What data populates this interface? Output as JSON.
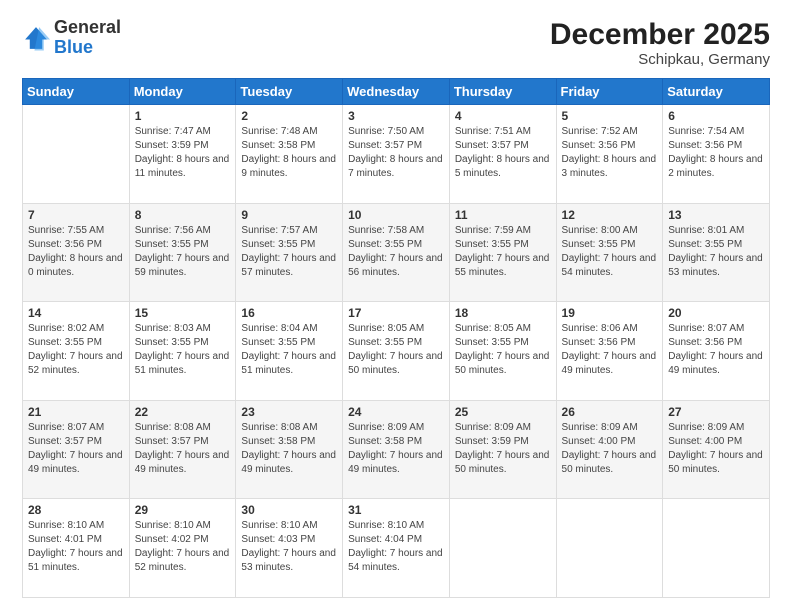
{
  "header": {
    "logo": {
      "general": "General",
      "blue": "Blue"
    },
    "title": "December 2025",
    "subtitle": "Schipkau, Germany"
  },
  "days_of_week": [
    "Sunday",
    "Monday",
    "Tuesday",
    "Wednesday",
    "Thursday",
    "Friday",
    "Saturday"
  ],
  "weeks": [
    [
      {
        "day": "",
        "sunrise": "",
        "sunset": "",
        "daylight": ""
      },
      {
        "day": "1",
        "sunrise": "Sunrise: 7:47 AM",
        "sunset": "Sunset: 3:59 PM",
        "daylight": "Daylight: 8 hours and 11 minutes."
      },
      {
        "day": "2",
        "sunrise": "Sunrise: 7:48 AM",
        "sunset": "Sunset: 3:58 PM",
        "daylight": "Daylight: 8 hours and 9 minutes."
      },
      {
        "day": "3",
        "sunrise": "Sunrise: 7:50 AM",
        "sunset": "Sunset: 3:57 PM",
        "daylight": "Daylight: 8 hours and 7 minutes."
      },
      {
        "day": "4",
        "sunrise": "Sunrise: 7:51 AM",
        "sunset": "Sunset: 3:57 PM",
        "daylight": "Daylight: 8 hours and 5 minutes."
      },
      {
        "day": "5",
        "sunrise": "Sunrise: 7:52 AM",
        "sunset": "Sunset: 3:56 PM",
        "daylight": "Daylight: 8 hours and 3 minutes."
      },
      {
        "day": "6",
        "sunrise": "Sunrise: 7:54 AM",
        "sunset": "Sunset: 3:56 PM",
        "daylight": "Daylight: 8 hours and 2 minutes."
      }
    ],
    [
      {
        "day": "7",
        "sunrise": "Sunrise: 7:55 AM",
        "sunset": "Sunset: 3:56 PM",
        "daylight": "Daylight: 8 hours and 0 minutes."
      },
      {
        "day": "8",
        "sunrise": "Sunrise: 7:56 AM",
        "sunset": "Sunset: 3:55 PM",
        "daylight": "Daylight: 7 hours and 59 minutes."
      },
      {
        "day": "9",
        "sunrise": "Sunrise: 7:57 AM",
        "sunset": "Sunset: 3:55 PM",
        "daylight": "Daylight: 7 hours and 57 minutes."
      },
      {
        "day": "10",
        "sunrise": "Sunrise: 7:58 AM",
        "sunset": "Sunset: 3:55 PM",
        "daylight": "Daylight: 7 hours and 56 minutes."
      },
      {
        "day": "11",
        "sunrise": "Sunrise: 7:59 AM",
        "sunset": "Sunset: 3:55 PM",
        "daylight": "Daylight: 7 hours and 55 minutes."
      },
      {
        "day": "12",
        "sunrise": "Sunrise: 8:00 AM",
        "sunset": "Sunset: 3:55 PM",
        "daylight": "Daylight: 7 hours and 54 minutes."
      },
      {
        "day": "13",
        "sunrise": "Sunrise: 8:01 AM",
        "sunset": "Sunset: 3:55 PM",
        "daylight": "Daylight: 7 hours and 53 minutes."
      }
    ],
    [
      {
        "day": "14",
        "sunrise": "Sunrise: 8:02 AM",
        "sunset": "Sunset: 3:55 PM",
        "daylight": "Daylight: 7 hours and 52 minutes."
      },
      {
        "day": "15",
        "sunrise": "Sunrise: 8:03 AM",
        "sunset": "Sunset: 3:55 PM",
        "daylight": "Daylight: 7 hours and 51 minutes."
      },
      {
        "day": "16",
        "sunrise": "Sunrise: 8:04 AM",
        "sunset": "Sunset: 3:55 PM",
        "daylight": "Daylight: 7 hours and 51 minutes."
      },
      {
        "day": "17",
        "sunrise": "Sunrise: 8:05 AM",
        "sunset": "Sunset: 3:55 PM",
        "daylight": "Daylight: 7 hours and 50 minutes."
      },
      {
        "day": "18",
        "sunrise": "Sunrise: 8:05 AM",
        "sunset": "Sunset: 3:55 PM",
        "daylight": "Daylight: 7 hours and 50 minutes."
      },
      {
        "day": "19",
        "sunrise": "Sunrise: 8:06 AM",
        "sunset": "Sunset: 3:56 PM",
        "daylight": "Daylight: 7 hours and 49 minutes."
      },
      {
        "day": "20",
        "sunrise": "Sunrise: 8:07 AM",
        "sunset": "Sunset: 3:56 PM",
        "daylight": "Daylight: 7 hours and 49 minutes."
      }
    ],
    [
      {
        "day": "21",
        "sunrise": "Sunrise: 8:07 AM",
        "sunset": "Sunset: 3:57 PM",
        "daylight": "Daylight: 7 hours and 49 minutes."
      },
      {
        "day": "22",
        "sunrise": "Sunrise: 8:08 AM",
        "sunset": "Sunset: 3:57 PM",
        "daylight": "Daylight: 7 hours and 49 minutes."
      },
      {
        "day": "23",
        "sunrise": "Sunrise: 8:08 AM",
        "sunset": "Sunset: 3:58 PM",
        "daylight": "Daylight: 7 hours and 49 minutes."
      },
      {
        "day": "24",
        "sunrise": "Sunrise: 8:09 AM",
        "sunset": "Sunset: 3:58 PM",
        "daylight": "Daylight: 7 hours and 49 minutes."
      },
      {
        "day": "25",
        "sunrise": "Sunrise: 8:09 AM",
        "sunset": "Sunset: 3:59 PM",
        "daylight": "Daylight: 7 hours and 50 minutes."
      },
      {
        "day": "26",
        "sunrise": "Sunrise: 8:09 AM",
        "sunset": "Sunset: 4:00 PM",
        "daylight": "Daylight: 7 hours and 50 minutes."
      },
      {
        "day": "27",
        "sunrise": "Sunrise: 8:09 AM",
        "sunset": "Sunset: 4:00 PM",
        "daylight": "Daylight: 7 hours and 50 minutes."
      }
    ],
    [
      {
        "day": "28",
        "sunrise": "Sunrise: 8:10 AM",
        "sunset": "Sunset: 4:01 PM",
        "daylight": "Daylight: 7 hours and 51 minutes."
      },
      {
        "day": "29",
        "sunrise": "Sunrise: 8:10 AM",
        "sunset": "Sunset: 4:02 PM",
        "daylight": "Daylight: 7 hours and 52 minutes."
      },
      {
        "day": "30",
        "sunrise": "Sunrise: 8:10 AM",
        "sunset": "Sunset: 4:03 PM",
        "daylight": "Daylight: 7 hours and 53 minutes."
      },
      {
        "day": "31",
        "sunrise": "Sunrise: 8:10 AM",
        "sunset": "Sunset: 4:04 PM",
        "daylight": "Daylight: 7 hours and 54 minutes."
      },
      {
        "day": "",
        "sunrise": "",
        "sunset": "",
        "daylight": ""
      },
      {
        "day": "",
        "sunrise": "",
        "sunset": "",
        "daylight": ""
      },
      {
        "day": "",
        "sunrise": "",
        "sunset": "",
        "daylight": ""
      }
    ]
  ]
}
